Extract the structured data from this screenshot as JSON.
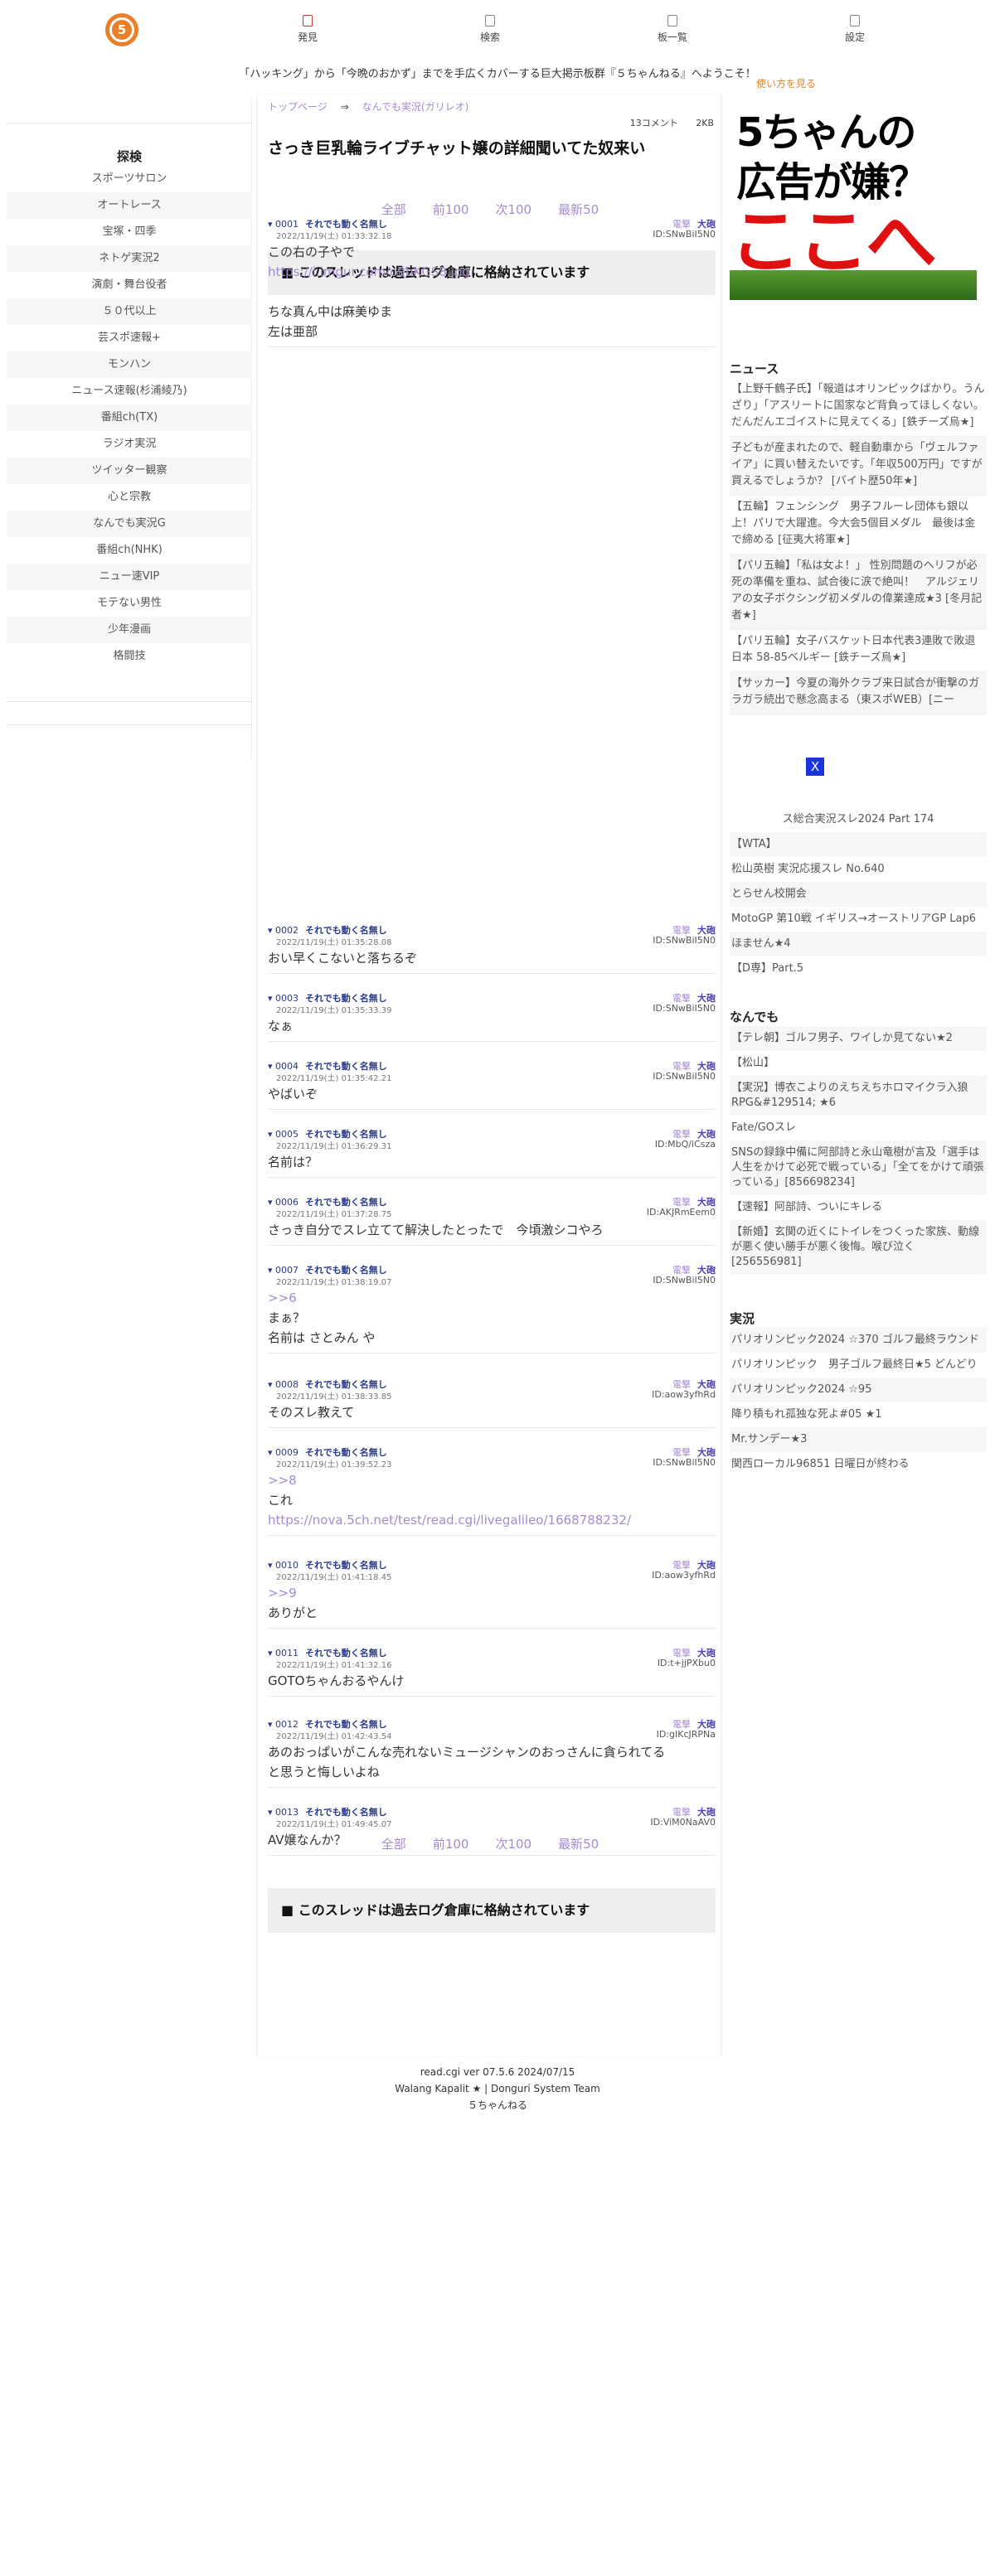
{
  "header": {
    "logo_text": "5",
    "nav": [
      {
        "label": "発見",
        "icon": "discover-icon"
      },
      {
        "label": "検索",
        "icon": "search-icon"
      },
      {
        "label": "板一覧",
        "icon": "board-list-icon"
      },
      {
        "label": "設定",
        "icon": "settings-icon"
      }
    ],
    "subtitle": "「ハッキング」から「今晩のおかず」までを手広くカバーする巨大掲示板群『５ちゃんねる』へようこそ！"
  },
  "left_sidebar": {
    "title": "探検",
    "items": [
      "スポーツサロン",
      "オートレース",
      "宝塚・四季",
      "ネトゲ実況2",
      "演劇・舞台役者",
      "５０代以上",
      "芸スポ速報+",
      "モンハン",
      "ニュース速報(杉浦綾乃)",
      "番組ch(TX)",
      "ラジオ実況",
      "ツイッター観察",
      "心と宗教",
      "なんでも実況G",
      "番組ch(NHK)",
      "ニュー速VIP",
      "モテない男性",
      "少年漫画",
      "格闘技"
    ]
  },
  "thread": {
    "breadcrumb": [
      "トップページ",
      "なんでも実況(ガリレオ)"
    ],
    "breadcrumb_arrow": "⇒",
    "comments": "13コメント",
    "size": "2KB",
    "title": "さっき巨乳輪ライブチャット嬢の詳細聞いてた奴来い",
    "pager": [
      "全部",
      "前100",
      "次100",
      "最新50"
    ],
    "archived": "■ このスレッドは過去ログ倉庫に格納されています",
    "link_labels": {
      "quote": "電撃",
      "big": "大砲"
    },
    "posts": [
      {
        "num": "0001",
        "name": "それでも動く名無し",
        "date": "2022/11/19(土) 01:33:32.18",
        "id": "ID:SNwBiI5N0",
        "lines": [
          "この右の子やで",
          "https://i.imgur.com/o9bKGS8.jpg",
          "",
          "ちな真ん中は麻美ゆま",
          "左は亜部"
        ]
      },
      {
        "num": "0002",
        "name": "それでも動く名無し",
        "date": "2022/11/19(土) 01:35:28.08",
        "id": "ID:SNwBiI5N0",
        "lines": [
          "おい早くこないと落ちるぞ"
        ]
      },
      {
        "num": "0003",
        "name": "それでも動く名無し",
        "date": "2022/11/19(土) 01:35:33.39",
        "id": "ID:SNwBiI5N0",
        "lines": [
          "なぁ"
        ]
      },
      {
        "num": "0004",
        "name": "それでも動く名無し",
        "date": "2022/11/19(土) 01:35:42.21",
        "id": "ID:SNwBiI5N0",
        "lines": [
          "やばいぞ"
        ]
      },
      {
        "num": "0005",
        "name": "それでも動く名無し",
        "date": "2022/11/19(土) 01:36:29.31",
        "id": "ID:MbQ/iCsza",
        "lines": [
          "名前は？"
        ]
      },
      {
        "num": "0006",
        "name": "それでも動く名無し",
        "date": "2022/11/19(土) 01:37:28.75",
        "id": "ID:AKJRmEem0",
        "lines": [
          "さっき自分でスレ立てて解決したとったで　今頃激シコやろ"
        ]
      },
      {
        "num": "0007",
        "name": "それでも動く名無し",
        "date": "2022/11/19(土) 01:38:19.07",
        "id": "ID:SNwBiI5N0",
        "lines": [
          ">>6",
          "まぁ？",
          "名前は さとみん や"
        ]
      },
      {
        "num": "0008",
        "name": "それでも動く名無し",
        "date": "2022/11/19(土) 01:38:33.85",
        "id": "ID:aow3yfhRd",
        "lines": [
          "そのスレ教えて"
        ]
      },
      {
        "num": "0009",
        "name": "それでも動く名無し",
        "date": "2022/11/19(土) 01:39:52.23",
        "id": "ID:SNwBiI5N0",
        "lines": [
          ">>8",
          "これ",
          "https://nova.5ch.net/test/read.cgi/livegalileo/1668788232/"
        ]
      },
      {
        "num": "0010",
        "name": "それでも動く名無し",
        "date": "2022/11/19(土) 01:41:18.45",
        "id": "ID:aow3yfhRd",
        "lines": [
          ">>9",
          "ありがと"
        ]
      },
      {
        "num": "0011",
        "name": "それでも動く名無し",
        "date": "2022/11/19(土) 01:41:32.16",
        "id": "ID:t+jjPXbu0",
        "lines": [
          "GOTOちゃんおるやんけ"
        ]
      },
      {
        "num": "0012",
        "name": "それでも動く名無し",
        "date": "2022/11/19(土) 01:42:43.54",
        "id": "ID:gIKcJRPNa",
        "lines": [
          "あのおっぱいがこんな売れないミュージシャンのおっさんに貪られてる",
          "と思うと悔しいよね"
        ]
      },
      {
        "num": "0013",
        "name": "それでも動く名無し",
        "date": "2022/11/19(土) 01:49:45.07",
        "id": "ID:ViM0NaAV0",
        "lines": [
          "AV嬢なんか？"
        ]
      }
    ]
  },
  "right_sidebar": {
    "howto": "使い方を見る",
    "ad": {
      "line1": "5ちゃんの",
      "line2": "広告が嫌？",
      "line3": "ここへ"
    },
    "news_title": "ニュース",
    "news": [
      "【上野千鶴子氏】「報道はオリンピックばかり。うんざり」「アスリートに国家など背負ってほしくない。だんだんエゴイストに見えてくる」[鉄チーズ烏★]",
      "子どもが産まれたので、軽自動車から「ヴェルファイア」に買い替えたいです。「年収500万円」ですが買えるでしょうか？ [バイト歴50年★]",
      "【五輪】フェンシング　男子フルーレ団体も銀以上！パリで大躍進。今大会5個目メダル　最後は金で締める [征夷大将軍★]",
      "【パリ五輪】「私は女よ！」 性別問題のヘリフが必死の準備を重ね、試合後に涙で絶叫！　アルジェリアの女子ボクシング初メダルの偉業達成★3 [冬月記者★]",
      "【パリ五輪】女子バスケット日本代表3連敗で敗退　日本 58-85ベルギー [鉄チーズ烏★]",
      "【サッカー】今夏の海外クラブ来日試合が衝撃のガラガラ続出で懸念高まる（東スポWEB）[ニー"
    ],
    "close_label": "X",
    "misc_first": "ス総合実況スレ2024 Part 174",
    "misc": [
      "【WTA】",
      "松山英樹 実況応援スレ No.640",
      "とらせん校開会",
      "MotoGP 第10戦 イギリス→オーストリアGP Lap6",
      "ほません★4",
      "【D専】Part.5"
    ],
    "nandemo_title": "なんでも",
    "nandemo": [
      "【テレ朝】ゴルフ男子、ワイしか見てない★2",
      "【松山】",
      "【実況】博衣こよりのえちえちホロマイクラ入狼RPG&#129514; ★6",
      "Fate/GOスレ",
      "SNSの録錄中備に阿部詩と永山竜樹が言及「選手は人生をかけて必死で戦っている」「全てをかけて頑張っている」[856698234]",
      "【速報】阿部詩、ついにキレる",
      "【新婚】玄関の近くにトイレをつくった家族、動線が悪く使い勝手が悪く後悔。喉び泣く [256556981]"
    ],
    "jikkyo_title": "実況",
    "jikkyo": [
      "パリオリンピック2024 ☆370 ゴルフ最終ラウンド",
      "パリオリンピック　男子ゴルフ最終日★5 どんどり",
      "パリオリンピック2024 ☆95",
      "降り積もれ孤独な死よ#05 ★1",
      "Mr.サンデー★3",
      "関西ローカル96851 日曜日が終わる"
    ]
  },
  "footer": {
    "lines": [
      "read.cgi ver 07.5.6 2024/07/15",
      "Walang Kapalit ★ | Donguri System Team",
      "５ちゃんねる"
    ]
  }
}
